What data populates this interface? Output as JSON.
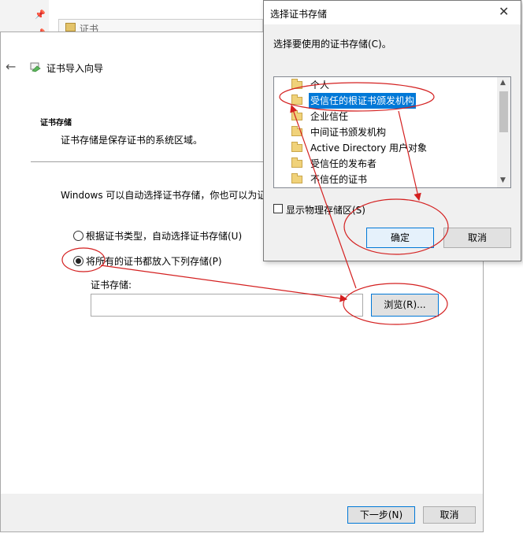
{
  "background": {
    "tab_label": "证书"
  },
  "wizard": {
    "title": "证书导入向导",
    "section_heading": "证书存储",
    "section_desc": "证书存储是保存证书的系统区域。",
    "intro": "Windows 可以自动选择证书存储，你也可以为证",
    "radio_auto_label": "根据证书类型，自动选择证书存储(U)",
    "radio_manual_label": "将所有的证书都放入下列存储(P)",
    "store_label": "证书存储:",
    "store_value": "",
    "browse_label": "浏览(R)...",
    "next_label": "下一步(N)",
    "cancel_label": "取消",
    "selected_radio": "manual"
  },
  "dialog": {
    "title": "选择证书存储",
    "prompt": "选择要使用的证书存储(C)。",
    "tree_items": [
      {
        "label": "个人",
        "selected": false
      },
      {
        "label": "受信任的根证书颁发机构",
        "selected": true
      },
      {
        "label": "企业信任",
        "selected": false
      },
      {
        "label": "中间证书颁发机构",
        "selected": false
      },
      {
        "label": "Active Directory 用户对象",
        "selected": false
      },
      {
        "label": "受信任的发布者",
        "selected": false
      },
      {
        "label": "不信任的证书",
        "selected": false
      }
    ],
    "show_physical_label": "显示物理存储区(S)",
    "show_physical_checked": false,
    "ok_label": "确定",
    "cancel_label": "取消"
  },
  "colors": {
    "annotation": "#d42020",
    "accent": "#0078d7"
  }
}
